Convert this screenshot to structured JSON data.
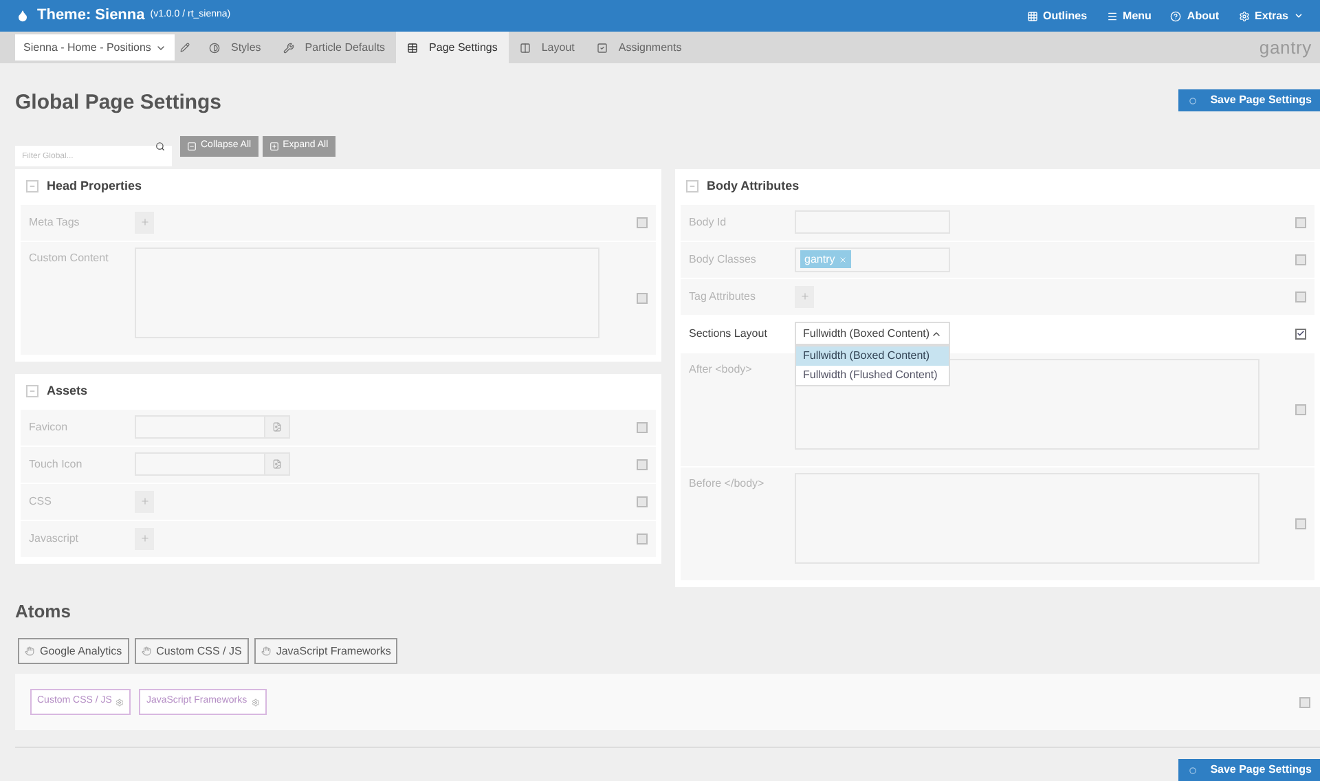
{
  "header": {
    "title": "Theme: Sienna",
    "version": "(v1.0.0 / rt_sienna)",
    "menu": [
      {
        "label": "Outlines",
        "dropdown": false
      },
      {
        "label": "Menu",
        "dropdown": false
      },
      {
        "label": "About",
        "dropdown": false
      },
      {
        "label": "Extras",
        "dropdown": true
      }
    ]
  },
  "outline_select": {
    "value": "Sienna - Home - Positions"
  },
  "tabs": [
    {
      "label": "Styles",
      "selected": false
    },
    {
      "label": "Particle Defaults",
      "selected": false
    },
    {
      "label": "Page Settings",
      "selected": true
    },
    {
      "label": "Layout",
      "selected": false
    },
    {
      "label": "Assignments",
      "selected": false
    }
  ],
  "logo": "gantry",
  "page_title": "Global Page Settings",
  "save_button": "Save Page Settings",
  "filter": {
    "placeholder": "Filter Global..."
  },
  "toolbar_buttons": [
    "Collapse All",
    "Expand All"
  ],
  "left_panels": [
    {
      "title": "Head Properties",
      "fields": [
        {
          "label": "Meta Tags",
          "kind": "plus",
          "checked": false
        },
        {
          "label": "Custom Content",
          "kind": "textarea",
          "checked": false
        }
      ]
    },
    {
      "title": "Assets",
      "fields": [
        {
          "label": "Favicon",
          "kind": "file",
          "checked": false
        },
        {
          "label": "Touch Icon",
          "kind": "file",
          "checked": false
        },
        {
          "label": "CSS",
          "kind": "plus",
          "checked": false
        },
        {
          "label": "Javascript",
          "kind": "plus",
          "checked": false
        }
      ]
    }
  ],
  "right_panels": [
    {
      "title": "Body Attributes",
      "fields": [
        {
          "label": "Body Id",
          "kind": "text",
          "checked": false
        },
        {
          "label": "Body Classes",
          "kind": "tags",
          "tags": [
            "gantry"
          ],
          "checked": false
        },
        {
          "label": "Tag Attributes",
          "kind": "plus",
          "checked": false
        },
        {
          "label": "Sections Layout",
          "kind": "select",
          "value": "Fullwidth (Boxed Content)",
          "expanded": true,
          "options": [
            {
              "label": "Fullwidth (Boxed Content)",
              "selected": true
            },
            {
              "label": "Fullwidth (Flushed Content)",
              "selected": false
            }
          ],
          "checked": true
        },
        {
          "label": "After <body>",
          "kind": "textarea",
          "checked": false
        },
        {
          "label": "Before </body>",
          "kind": "textarea",
          "checked": false
        }
      ]
    }
  ],
  "atoms": {
    "title": "Atoms",
    "available": [
      "Google Analytics",
      "Custom CSS / JS",
      "JavaScript Frameworks"
    ],
    "active": [
      "Custom CSS / JS",
      "JavaScript Frameworks"
    ],
    "checked": false
  },
  "footer_save_button": "Save Page Settings"
}
